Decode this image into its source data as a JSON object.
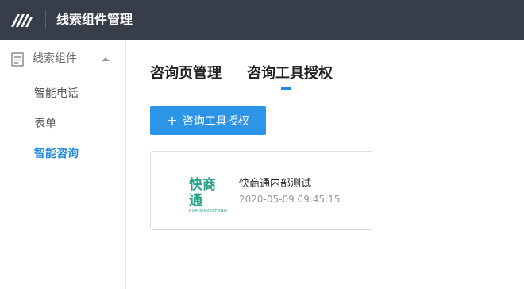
{
  "header": {
    "logo_icon": "brand-stripes-logo",
    "title": "线索组件管理"
  },
  "sidebar": {
    "group": {
      "icon": "document-icon",
      "label": "线索组件",
      "expanded": true
    },
    "items": [
      {
        "label": "智能电话",
        "active": false
      },
      {
        "label": "表单",
        "active": false
      },
      {
        "label": "智能咨询",
        "active": true
      }
    ]
  },
  "main": {
    "tabs": [
      {
        "label": "咨询页管理",
        "active": false
      },
      {
        "label": "咨询工具授权",
        "active": true
      }
    ],
    "primary_button": {
      "icon": "plus-icon",
      "label": "咨询工具授权"
    },
    "cards": [
      {
        "logo_text": "快商通",
        "logo_subtext": "KUAISHANGTONG",
        "title": "快商通内部测试",
        "time": "2020-05-09 09:45:15"
      }
    ]
  },
  "colors": {
    "topbar": "#373d49",
    "accent": "#1e88e5",
    "button": "#2d95e8",
    "brand": "#2aa18a"
  }
}
